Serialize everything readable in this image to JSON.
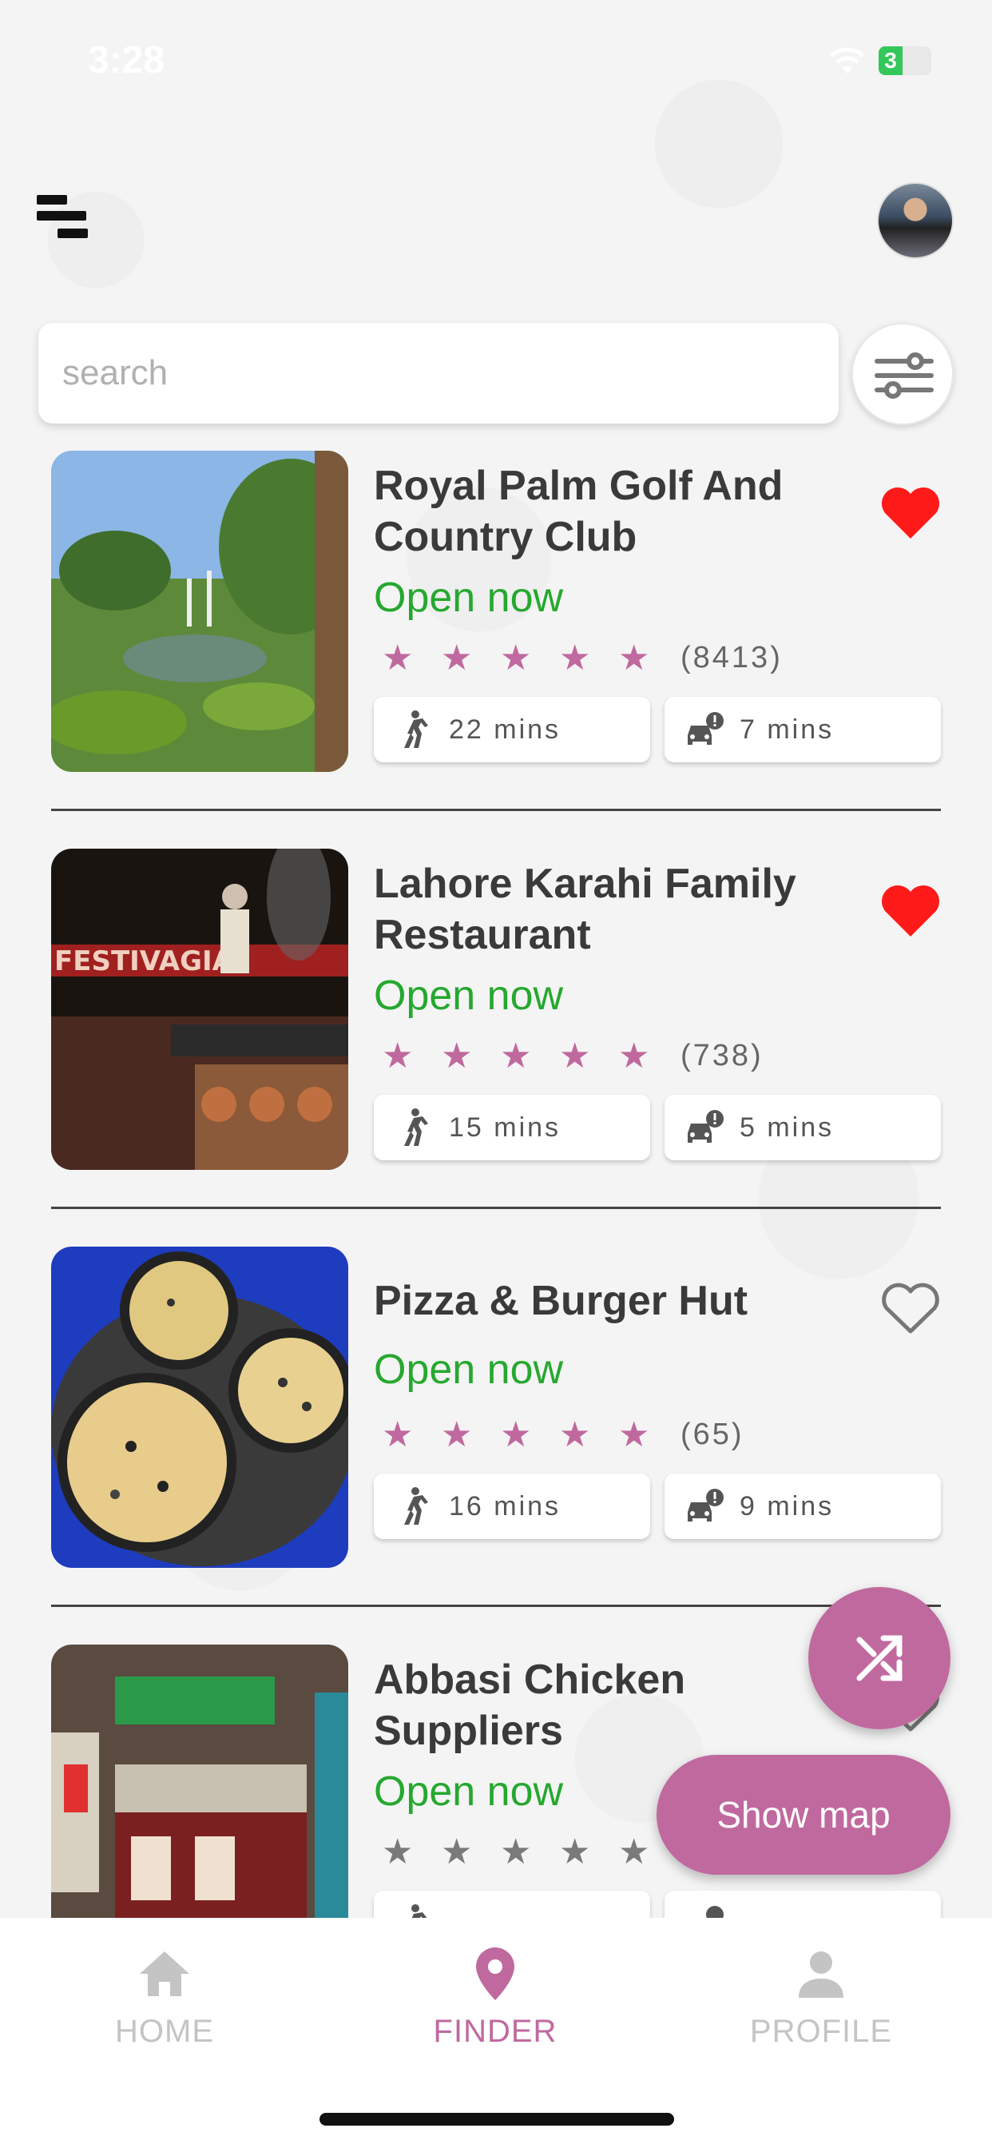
{
  "status_bar": {
    "time": "3:28",
    "battery": "3"
  },
  "search": {
    "placeholder": "search",
    "value": ""
  },
  "places": [
    {
      "name": "Royal Palm Golf And Country Club",
      "status": "Open now",
      "rating": 4.5,
      "review_count": "(8413)",
      "walk_time": "22 mins",
      "drive_time": "7 mins",
      "favorite": true
    },
    {
      "name": "Lahore Karahi Family Restaurant",
      "status": "Open now",
      "rating": 4.5,
      "review_count": "(738)",
      "walk_time": "15 mins",
      "drive_time": "5 mins",
      "favorite": true
    },
    {
      "name": "Pizza & Burger Hut",
      "status": "Open now",
      "rating": 4.5,
      "review_count": "(65)",
      "walk_time": "16 mins",
      "drive_time": "9 mins",
      "favorite": false
    },
    {
      "name": "Abbasi Chicken Suppliers",
      "status": "Open now",
      "rating": 0,
      "review_count": "",
      "walk_time": "",
      "drive_time": "",
      "favorite": false
    }
  ],
  "actions": {
    "show_map": "Show map"
  },
  "nav": {
    "home": "HOME",
    "finder": "FINDER",
    "profile": "PROFILE"
  },
  "colors": {
    "accent": "#c0699f",
    "open": "#25a82e",
    "heart": "#ff1a1a"
  }
}
